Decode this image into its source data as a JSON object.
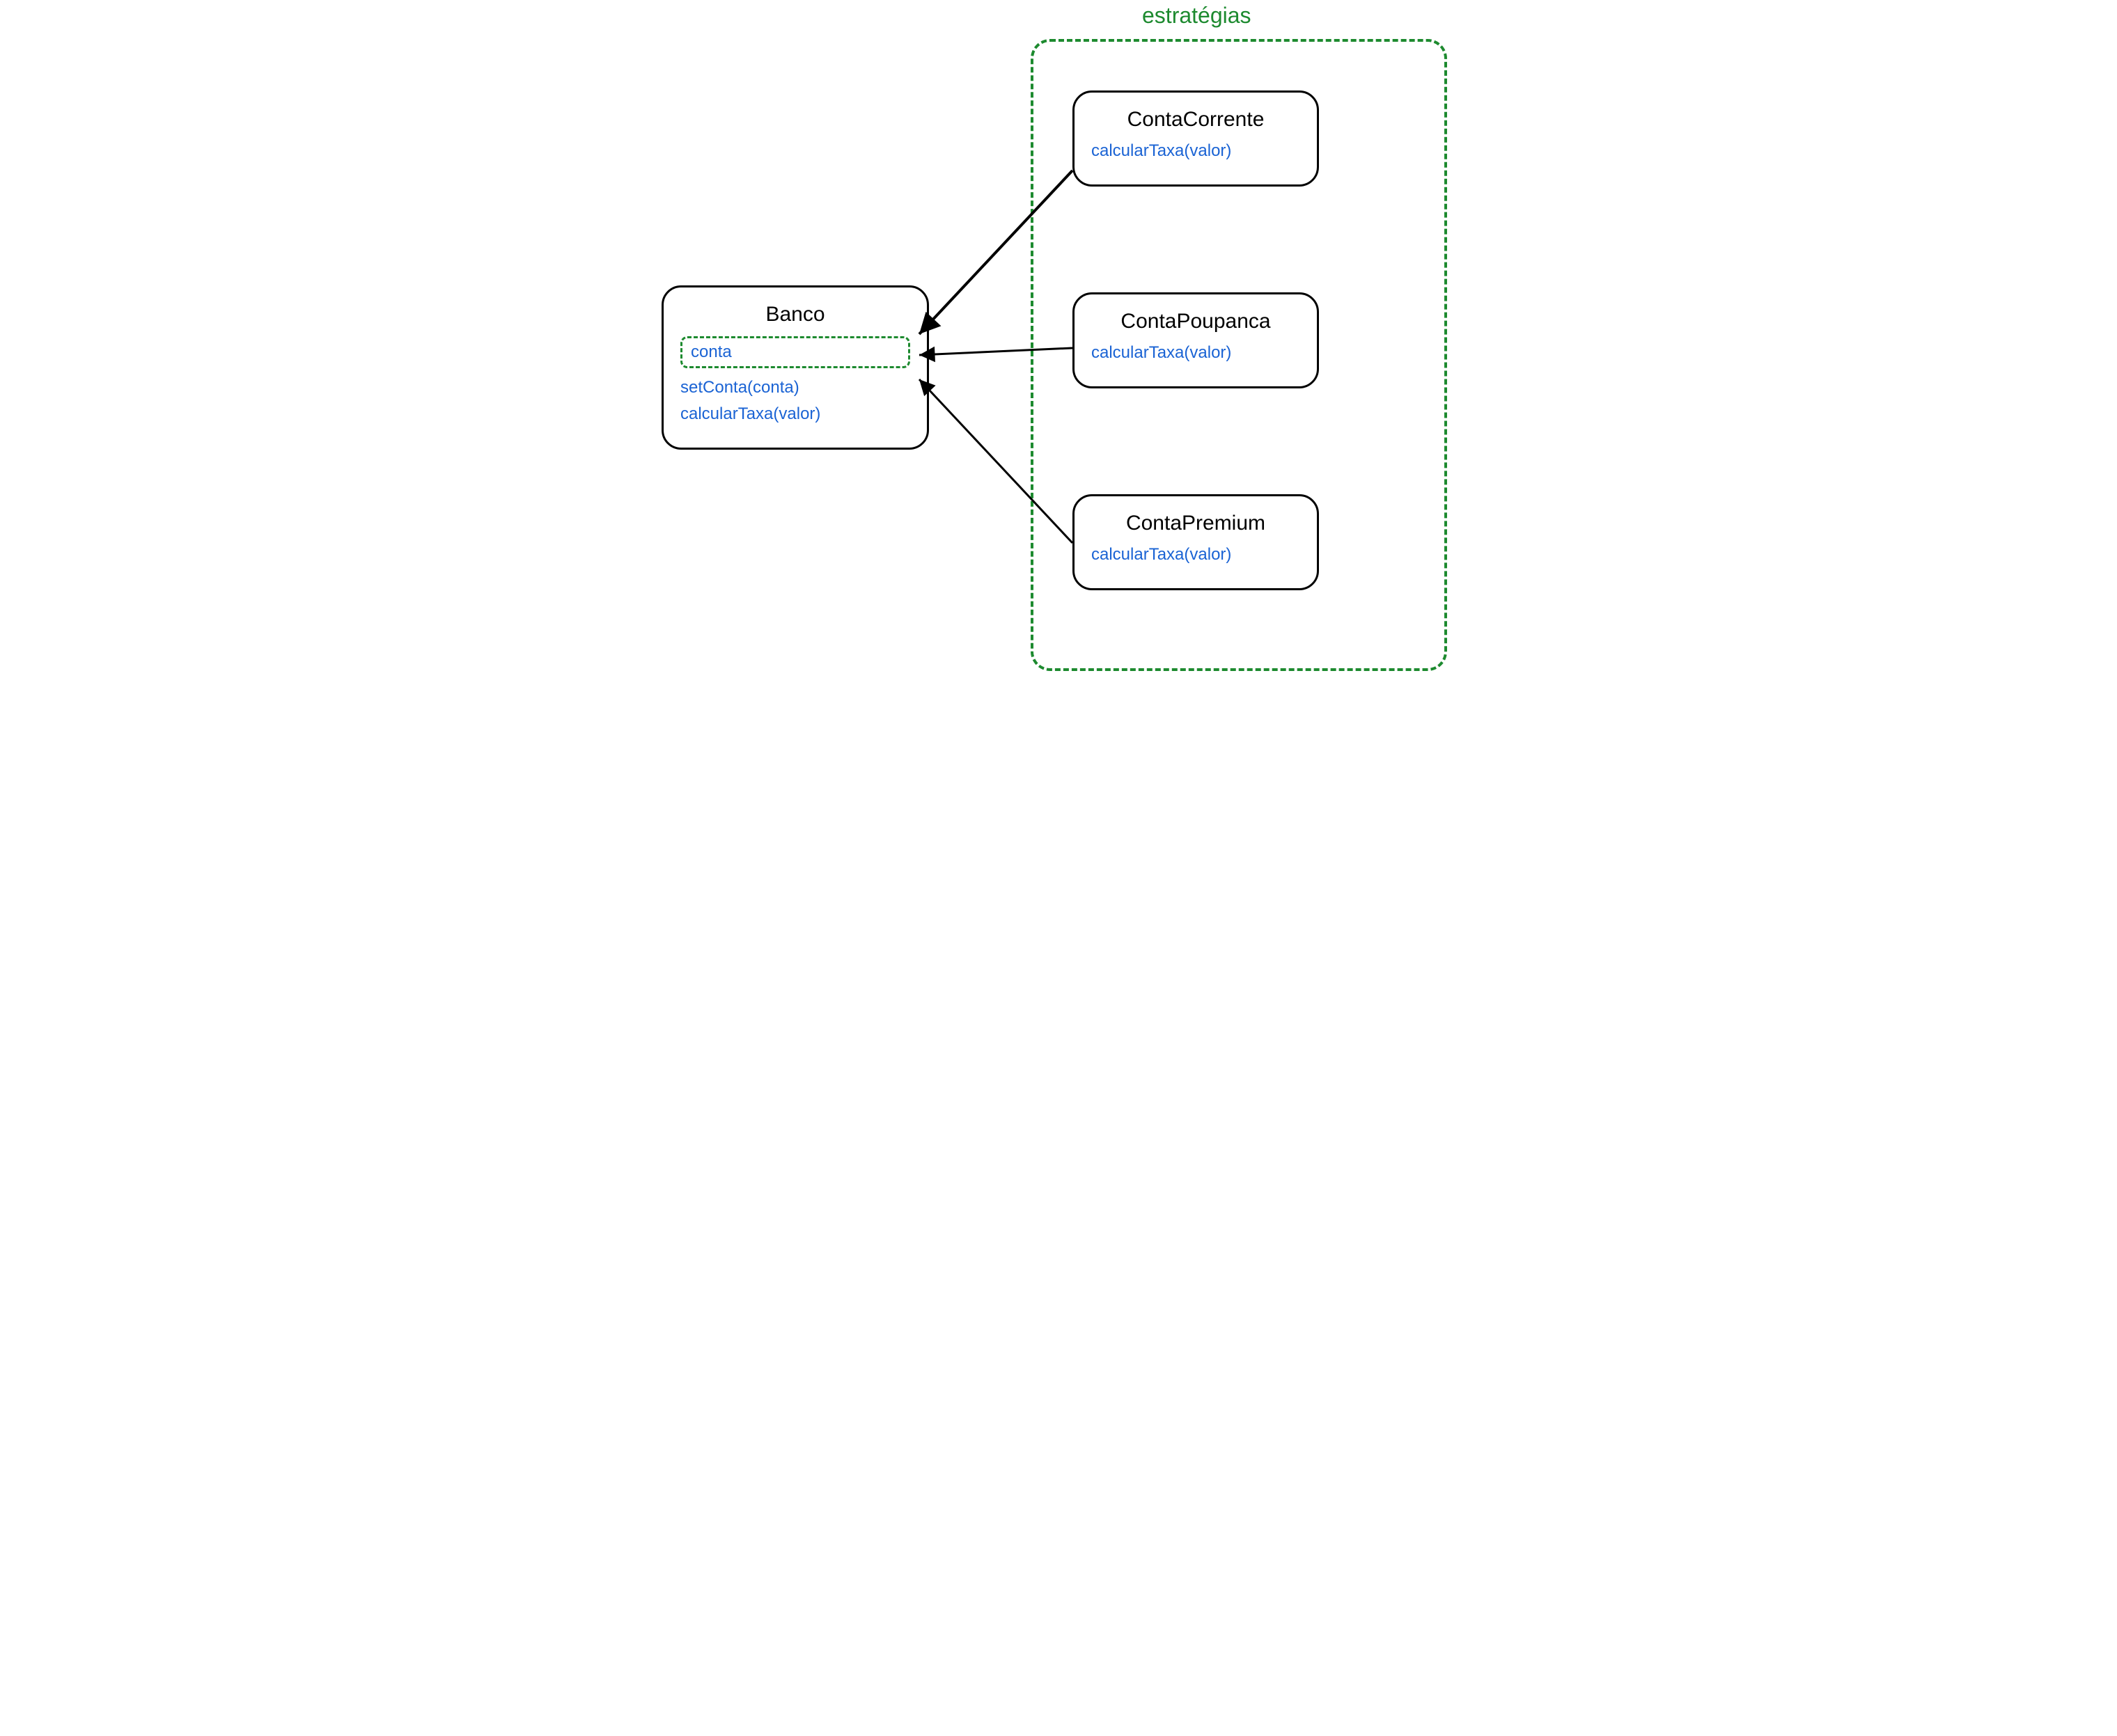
{
  "group": {
    "label": "estratégias"
  },
  "context": {
    "title": "Banco",
    "field": "conta",
    "methods": [
      "setConta(conta)",
      "calcularTaxa(valor)"
    ]
  },
  "strategies": [
    {
      "title": "ContaCorrente",
      "method": "calcularTaxa(valor)"
    },
    {
      "title": "ContaPoupanca",
      "method": "calcularTaxa(valor)"
    },
    {
      "title": "ContaPremium",
      "method": "calcularTaxa(valor)"
    }
  ],
  "colors": {
    "accent": "#1d8a2f",
    "link": "#1a63d4",
    "stroke": "#000000"
  }
}
